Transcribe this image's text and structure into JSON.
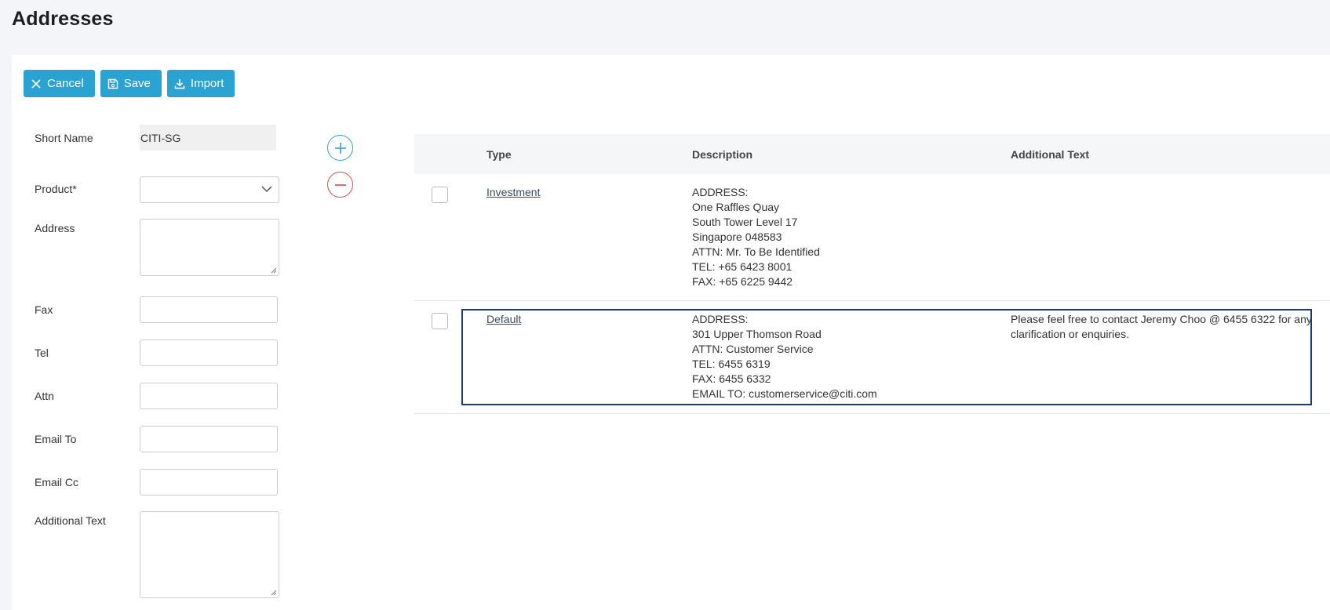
{
  "page": {
    "title": "Addresses"
  },
  "toolbar": {
    "cancel_label": "Cancel",
    "save_label": "Save",
    "import_label": "Import"
  },
  "form": {
    "short_name": {
      "label": "Short Name",
      "value": "CITI-SG"
    },
    "product": {
      "label": "Product*",
      "value": ""
    },
    "address": {
      "label": "Address",
      "value": ""
    },
    "fax": {
      "label": "Fax",
      "value": ""
    },
    "tel": {
      "label": "Tel",
      "value": ""
    },
    "attn": {
      "label": "Attn",
      "value": ""
    },
    "email_to": {
      "label": "Email To",
      "value": ""
    },
    "email_cc": {
      "label": "Email Cc",
      "value": ""
    },
    "additional_text": {
      "label": "Additional Text",
      "value": ""
    }
  },
  "table": {
    "headers": {
      "type": "Type",
      "description": "Description",
      "additional_text": "Additional Text"
    },
    "rows": [
      {
        "type": "Investment",
        "description": [
          "ADDRESS:",
          "One Raffles Quay",
          "South Tower Level 17",
          "Singapore 048583",
          "ATTN: Mr. To Be Identified",
          "TEL: +65 6423 8001",
          "FAX: +65 6225 9442"
        ],
        "additional_text": "",
        "checked": false,
        "selected": false
      },
      {
        "type": "Default",
        "description": [
          "ADDRESS:",
          "301 Upper Thomson Road",
          "ATTN: Customer Service",
          "TEL: 6455 6319",
          "FAX: 6455 6332",
          "EMAIL TO: customerservice@citi.com"
        ],
        "additional_text": "Please feel free to contact Jeremy Choo @ 6455 6322 for any clarification or enquiries.",
        "checked": false,
        "selected": true
      }
    ]
  },
  "icons": {
    "cancel": "x-icon",
    "save": "floppy-disk-icon",
    "import": "download-icon",
    "add": "plus-circle-icon",
    "remove": "minus-circle-icon",
    "dropdown": "chevron-down-icon"
  },
  "colors": {
    "accent": "#2aa3d3",
    "danger": "#e0483e",
    "selection": "#1c3a7a"
  }
}
